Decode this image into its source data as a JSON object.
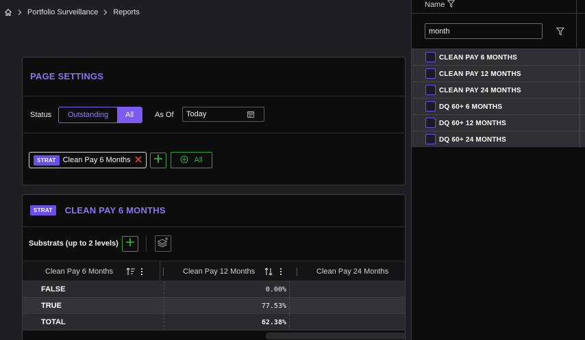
{
  "breadcrumb": {
    "home_icon": "home-icon",
    "items": [
      "Portfolio Surveillance",
      "Reports"
    ]
  },
  "page_settings": {
    "title": "PAGE SETTINGS",
    "status_label": "Status",
    "status_options": [
      "Outstanding",
      "All"
    ],
    "status_selected": "All",
    "as_of_label": "As Of",
    "as_of_value": "Today",
    "chip": {
      "tag": "STRAT",
      "label": "Clean Pay 6 Months"
    },
    "all_button": "All"
  },
  "strat": {
    "tag": "STRAT",
    "title": "CLEAN PAY 6 MONTHS",
    "substrats_label": "Substrats (up to 2 levels)",
    "columns": [
      "Clean Pay 6 Months",
      "Clean Pay 12 Months",
      "Clean Pay 24 Months"
    ],
    "rows": [
      {
        "label": "FALSE",
        "value": "0.00%"
      },
      {
        "label": "TRUE",
        "value": "77.53%"
      },
      {
        "label": "TOTAL",
        "value": "62.38%"
      }
    ]
  },
  "filter_panel": {
    "column_header": "Name",
    "search_value": "month",
    "options": [
      "CLEAN PAY 6 MONTHS",
      "CLEAN PAY 12 MONTHS",
      "CLEAN PAY 24 MONTHS",
      "DQ 60+ 6 MONTHS",
      "DQ 60+ 12 MONTHS",
      "DQ 60+ 24 MONTHS"
    ]
  },
  "colors": {
    "accent": "#8c73f0",
    "tag_bg": "#6a4ee8",
    "add_green": "#2f9e3e",
    "remove_red": "#e0443c"
  }
}
